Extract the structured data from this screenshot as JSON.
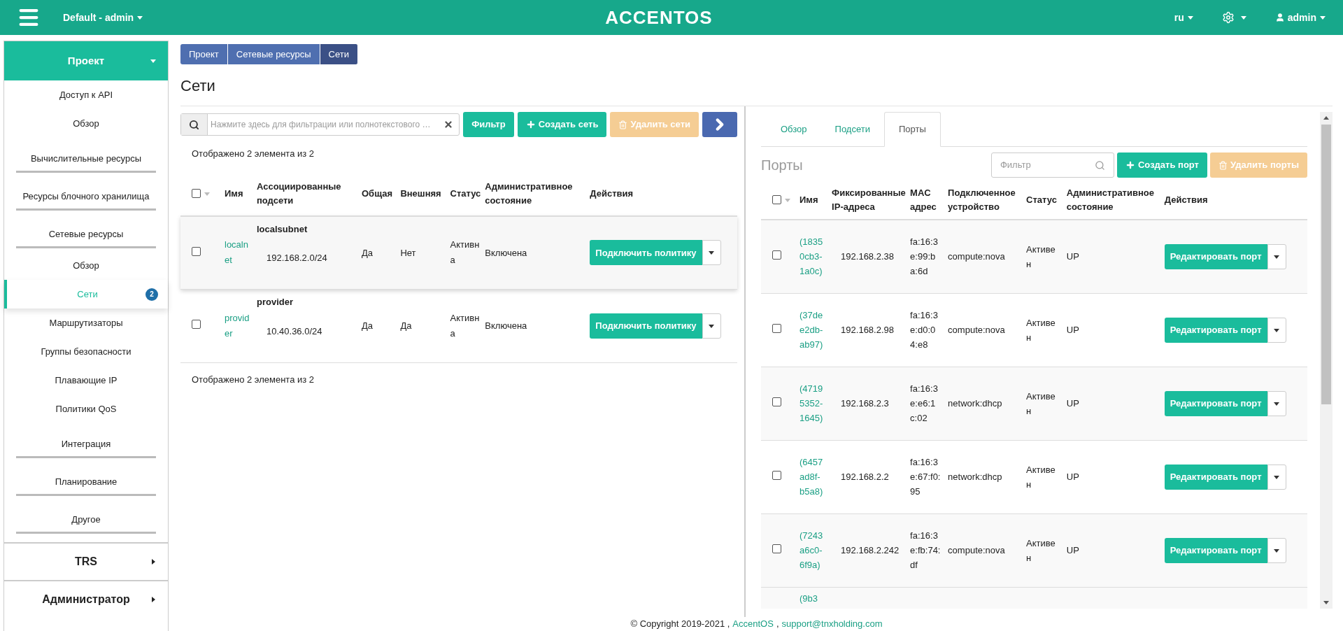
{
  "header": {
    "project_menu": "Default - admin",
    "logo": "ACCENTOS",
    "language": "ru",
    "user": "admin"
  },
  "sidebar": {
    "panels": [
      {
        "label": "Проект",
        "expanded": true,
        "items": [
          {
            "label": "Доступ к API",
            "kind": "link",
            "selected": false
          },
          {
            "label": "Обзор",
            "kind": "link",
            "selected": false
          },
          {
            "label": "Вычислительные ресурсы",
            "kind": "group"
          },
          {
            "label": "Ресурсы блочного хранилища",
            "kind": "group"
          },
          {
            "label": "Сетевые ресурсы",
            "kind": "group",
            "children": [
              {
                "label": "Обзор",
                "kind": "link",
                "selected": false
              },
              {
                "label": "Сети",
                "kind": "link",
                "selected": true,
                "badge": "2"
              },
              {
                "label": "Маршрутизаторы",
                "kind": "link",
                "selected": false
              },
              {
                "label": "Группы безопасности",
                "kind": "link",
                "selected": false
              },
              {
                "label": "Плавающие IP",
                "kind": "link",
                "selected": false
              },
              {
                "label": "Политики QoS",
                "kind": "link",
                "selected": false
              }
            ]
          },
          {
            "label": "Интеграция",
            "kind": "group"
          },
          {
            "label": "Планирование",
            "kind": "group"
          },
          {
            "label": "Другое",
            "kind": "group"
          }
        ]
      },
      {
        "label": "TRS",
        "expanded": false
      },
      {
        "label": "Администратор",
        "expanded": false
      }
    ]
  },
  "breadcrumb": [
    "Проект",
    "Сетевые ресурсы",
    "Сети"
  ],
  "page_title": "Сети",
  "networks": {
    "filter": {
      "placeholder": "Нажмите здесь для фильтрации или полнотекстового …"
    },
    "buttons": [
      {
        "label": "Фильтр",
        "kind": "filter",
        "disabled": false
      },
      {
        "label": "Создать сеть",
        "kind": "create",
        "disabled": false
      },
      {
        "label": "Удалить сети",
        "kind": "delete",
        "disabled": true
      },
      {
        "kind": "next",
        "disabled": false
      }
    ],
    "count_top": "Отображено 2 элемента из 2",
    "columns": [
      "Имя",
      "Ассоциированные подсети",
      "Общая",
      "Внешняя",
      "Статус",
      "Административное состояние",
      "Действия"
    ],
    "select_all": {
      "checked": false
    },
    "rows": [
      {
        "checked": false,
        "highlighted": true,
        "name": "localnet",
        "subnet_name": "localsubnet",
        "subnet_cidr": "192.168.2.0/24",
        "shared": "Да",
        "external": "Нет",
        "status": "Активна",
        "admin_state": "Включена",
        "action": "Подключить политику"
      },
      {
        "checked": false,
        "highlighted": false,
        "name": "provider",
        "subnet_name": "provider",
        "subnet_cidr": "10.40.36.0/24",
        "shared": "Да",
        "external": "Да",
        "status": "Активна",
        "admin_state": "Включена",
        "action": "Подключить политику"
      }
    ],
    "count_bottom": "Отображено 2 элемента из 2"
  },
  "details": {
    "tabs": [
      {
        "label": "Обзор",
        "selected": false
      },
      {
        "label": "Подсети",
        "selected": false
      },
      {
        "label": "Порты",
        "selected": true
      }
    ],
    "title": "Порты",
    "filter": {
      "placeholder": "Фильтр"
    },
    "buttons": [
      {
        "label": "Создать порт",
        "kind": "create",
        "disabled": false
      },
      {
        "label": "Удалить порты",
        "kind": "delete",
        "disabled": true
      }
    ],
    "columns": [
      "Имя",
      "Фиксированные IP-адреса",
      "MAC адрес",
      "Подключенное устройство",
      "Статус",
      "Административное состояние",
      "Действия"
    ],
    "select_all": {
      "checked": false
    },
    "rows": [
      {
        "checked": false,
        "name": "(18350cb3-1a0c)",
        "ip": "192.168.2.38",
        "mac": "fa:16:3e:99:ba:6d",
        "device": "compute:nova",
        "status": "Активен",
        "admin_state": "UP",
        "action": "Редактировать порт"
      },
      {
        "checked": false,
        "name": "(37dee2db-ab97)",
        "ip": "192.168.2.98",
        "mac": "fa:16:3e:d0:04:e8",
        "device": "compute:nova",
        "status": "Активен",
        "admin_state": "UP",
        "action": "Редактировать порт"
      },
      {
        "checked": false,
        "name": "(47195352-1645)",
        "ip": "192.168.2.3",
        "mac": "fa:16:3e:e6:1c:02",
        "device": "network:dhcp",
        "status": "Активен",
        "admin_state": "UP",
        "action": "Редактировать порт"
      },
      {
        "checked": false,
        "name": "(6457ad8f-b5a8)",
        "ip": "192.168.2.2",
        "mac": "fa:16:3e:67:f0:95",
        "device": "network:dhcp",
        "status": "Активен",
        "admin_state": "UP",
        "action": "Редактировать порт"
      },
      {
        "checked": false,
        "name": "(7243a6c0-6f9a)",
        "ip": "192.168.2.242",
        "mac": "fa:16:3e:fb:74:df",
        "device": "compute:nova",
        "status": "Активен",
        "admin_state": "UP",
        "action": "Редактировать порт"
      }
    ],
    "partial_row": {
      "name": "(9b3"
    }
  },
  "footer": {
    "copyright": "© Copyright 2019-2021 ,",
    "brand_link": "AccentOS",
    "separator": ",",
    "email_link": "support@tnxholding.com"
  }
}
